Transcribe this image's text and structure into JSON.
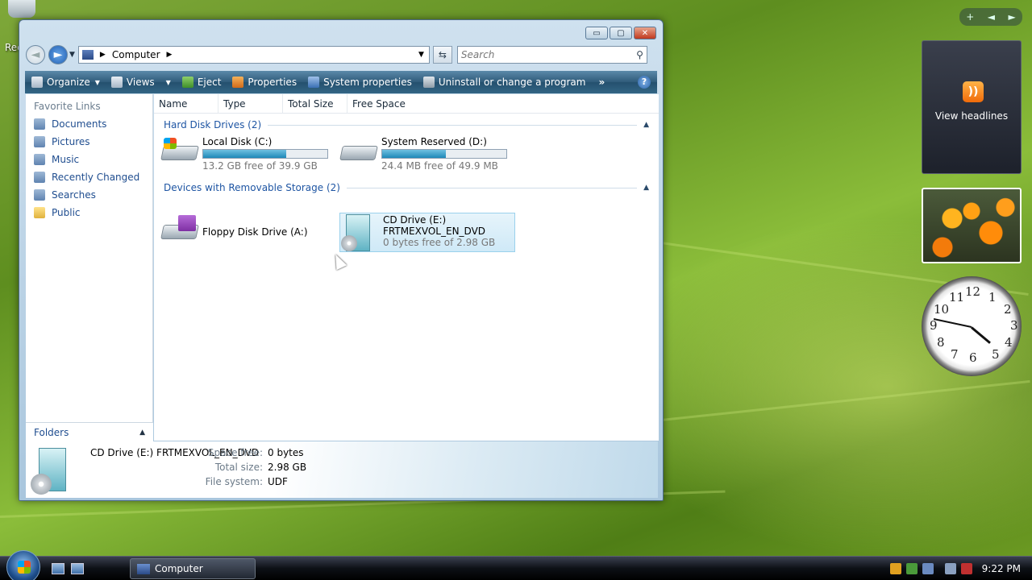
{
  "desktop": {
    "recycle_label": "Rec"
  },
  "window": {
    "title": "Computer",
    "buttons": {
      "minimize": "▭",
      "maximize": "▢",
      "close": "✕"
    },
    "address": {
      "location": "Computer"
    },
    "search": {
      "placeholder": "Search"
    },
    "toolbar": {
      "organize": "Organize",
      "views": "Views",
      "eject": "Eject",
      "properties": "Properties",
      "system_properties": "System properties",
      "uninstall": "Uninstall or change a program",
      "more": "»",
      "help": "?"
    },
    "sidebar": {
      "header": "Favorite Links",
      "links": [
        {
          "label": "Documents",
          "icon": "documents-icon"
        },
        {
          "label": "Pictures",
          "icon": "pictures-icon"
        },
        {
          "label": "Music",
          "icon": "music-icon"
        },
        {
          "label": "Recently Changed",
          "icon": "recently-changed-icon"
        },
        {
          "label": "Searches",
          "icon": "searches-icon"
        },
        {
          "label": "Public",
          "icon": "folder-icon"
        }
      ],
      "folders": "Folders"
    },
    "columns": [
      "Name",
      "Type",
      "Total Size",
      "Free Space"
    ],
    "groups": {
      "hard_disks": "Hard Disk Drives (2)",
      "removable": "Devices with Removable Storage (2)"
    },
    "drives": {
      "c": {
        "name": "Local Disk (C:)",
        "free": "13.2 GB free of 39.9 GB",
        "used_fraction": 0.67
      },
      "d": {
        "name": "System Reserved (D:)",
        "free": "24.4 MB free of 49.9 MB",
        "used_fraction": 0.51
      },
      "a": {
        "name": "Floppy Disk Drive (A:)"
      },
      "e": {
        "name": "CD Drive (E:)",
        "label": "FRTMEXVOL_EN_DVD",
        "free": "0 bytes free of 2.98 GB"
      }
    },
    "details": {
      "name": "CD Drive (E:) FRTMEXVOL_EN_DVD",
      "space_free_label": "Space free:",
      "space_free": "0 bytes",
      "total_size_label": "Total size:",
      "total_size": "2.98 GB",
      "file_system_label": "File system:",
      "file_system": "UDF"
    }
  },
  "gadgets": {
    "rss_label": "View headlines",
    "add": "+",
    "prev": "◄",
    "next": "►"
  },
  "taskbar": {
    "window_button": "Computer",
    "time": "9:22 PM"
  }
}
